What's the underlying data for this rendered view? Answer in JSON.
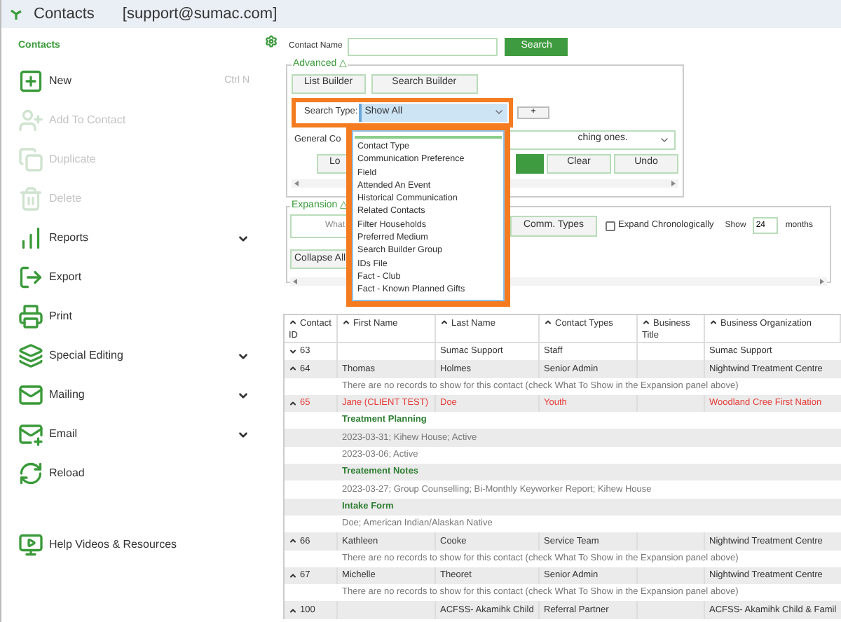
{
  "window": {
    "title": "Contacts",
    "account": "[support@sumac.com]"
  },
  "sidebar": {
    "heading": "Contacts",
    "items": [
      {
        "label": "New",
        "shortcut": "Ctrl N",
        "disabled": false,
        "submenu": false
      },
      {
        "label": "Add To Contact",
        "disabled": true,
        "submenu": false
      },
      {
        "label": "Duplicate",
        "disabled": true,
        "submenu": false
      },
      {
        "label": "Delete",
        "disabled": true,
        "submenu": false
      },
      {
        "label": "Reports",
        "disabled": false,
        "submenu": true
      },
      {
        "label": "Export",
        "disabled": false,
        "submenu": false
      },
      {
        "label": "Print",
        "disabled": false,
        "submenu": false
      },
      {
        "label": "Special Editing",
        "disabled": false,
        "submenu": true
      },
      {
        "label": "Mailing",
        "disabled": false,
        "submenu": true
      },
      {
        "label": "Email",
        "disabled": false,
        "submenu": true
      },
      {
        "label": "Reload",
        "disabled": false,
        "submenu": false
      },
      {
        "label": "Help Videos & Resources",
        "disabled": false,
        "submenu": false
      }
    ]
  },
  "search": {
    "label": "Contact Name",
    "button": "Search"
  },
  "advanced": {
    "legend": "Advanced △",
    "buttons": [
      "List Builder",
      "Search Builder"
    ],
    "search_type": {
      "label": "Search Type:",
      "value": "Show All"
    },
    "add_button": "+",
    "general": {
      "label": "General Co",
      "value": "ching ones."
    },
    "actions": [
      {
        "label": "Lo",
        "kind": "default"
      },
      {
        "kind": "primary"
      },
      {
        "label": "Clear",
        "kind": "default"
      },
      {
        "label": "Undo",
        "kind": "default"
      }
    ]
  },
  "dropdown": {
    "options": [
      "Contact Type",
      "Communication Preference",
      "Field",
      "Attended An Event",
      "Historical Communication",
      "Related Contacts",
      "Filter Households",
      "Preferred Medium",
      "Search Builder Group",
      "IDs File",
      "Fact - Club",
      "Fact - Known Planned Gifts"
    ]
  },
  "expansion": {
    "legend": "Expansion △",
    "what_button": "What",
    "comm_button": "Comm. Types",
    "expand_chronologically": {
      "label": "Expand Chronologically",
      "checked": false
    },
    "show_label": "Show",
    "months_value": "24",
    "months_label": "months",
    "collapse_button": "Collapse All"
  },
  "table": {
    "columns": [
      "Contact ID",
      "First Name",
      "Last Name",
      "Contact Types",
      "Business Title",
      "Business Organization"
    ],
    "rows": [
      {
        "kind": "contact",
        "expanded": false,
        "flagged": false,
        "cells": [
          "63",
          "",
          "Sumac Support",
          "Staff",
          "",
          "Sumac Support"
        ]
      },
      {
        "kind": "contact",
        "expanded": true,
        "flagged": false,
        "cells": [
          "64",
          "Thomas",
          "Holmes",
          "Senior Admin",
          "",
          "Nightwind Treatment Centre"
        ]
      },
      {
        "kind": "message",
        "text": "There are no records to show for this contact (check What To Show in the Expansion panel above)"
      },
      {
        "kind": "contact",
        "expanded": true,
        "flagged": true,
        "cells": [
          "65",
          "Jane (CLIENT TEST)",
          "Doe",
          "Youth",
          "",
          "Woodland Cree First Nation"
        ]
      },
      {
        "kind": "section",
        "text": "Treatment Planning"
      },
      {
        "kind": "detail",
        "text": "2023-03-31; Kihew House; Active"
      },
      {
        "kind": "detail",
        "text": "2023-03-06; Active"
      },
      {
        "kind": "section",
        "text": "Treatement Notes"
      },
      {
        "kind": "detail",
        "text": "2023-03-27; Group Counselling; Bi-Monthly Keyworker Report; Kihew House"
      },
      {
        "kind": "section",
        "text": "Intake Form"
      },
      {
        "kind": "detail",
        "text": "Doe; American Indian/Alaskan Native"
      },
      {
        "kind": "contact",
        "expanded": true,
        "flagged": false,
        "cells": [
          "66",
          "Kathleen",
          "Cooke",
          "Service Team",
          "",
          "Nightwind Treatment Centre"
        ]
      },
      {
        "kind": "message",
        "text": "There are no records to show for this contact (check What To Show in the Expansion panel above)"
      },
      {
        "kind": "contact",
        "expanded": true,
        "flagged": false,
        "cells": [
          "67",
          "Michelle",
          "Theoret",
          "Senior Admin",
          "",
          "Nightwind Treatment Centre"
        ]
      },
      {
        "kind": "message",
        "text": "There are no records to show for this contact (check What To Show in the Expansion panel above)"
      },
      {
        "kind": "contact",
        "expanded": true,
        "flagged": false,
        "cells": [
          "100",
          "",
          "ACFSS- Akamihk Child",
          "Referral Partner",
          "",
          "ACFSS- Akamihk Child & Famil"
        ]
      }
    ]
  }
}
